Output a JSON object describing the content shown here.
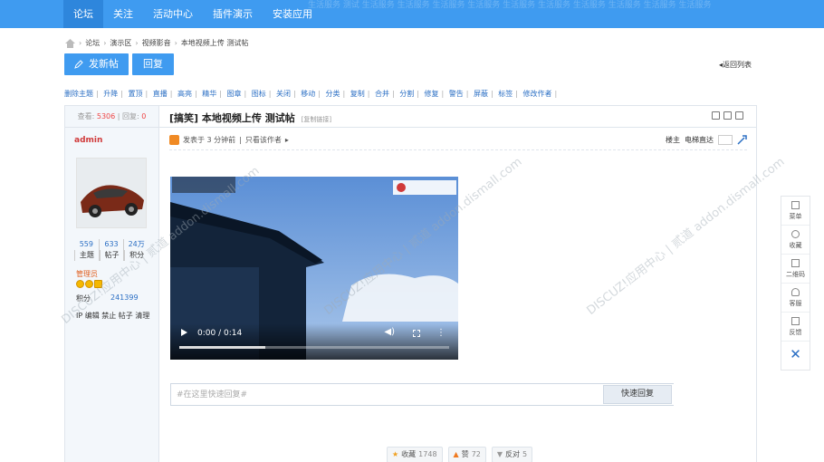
{
  "nav": {
    "items": [
      "论坛",
      "关注",
      "活动中心",
      "插件演示",
      "安装应用"
    ],
    "ghost": "生活服务 测试 生活服务 生活服务 生活服务 生活服务 生活服务 生活服务 生活服务 生活服务 生活服务 生活服务"
  },
  "breadcrumb": [
    "论坛",
    "演示区",
    "视频影音",
    "本地视频上传 测试帖"
  ],
  "buttons": {
    "new_post": "发新帖",
    "reply": "回复",
    "back_list": "返回列表"
  },
  "mod_actions": [
    "删除主题",
    "升降",
    "置顶",
    "直播",
    "高亮",
    "精华",
    "图章",
    "图标",
    "关闭",
    "移动",
    "分类",
    "复制",
    "合并",
    "分割",
    "修复",
    "警告",
    "屏蔽",
    "标签",
    "修改作者"
  ],
  "thread": {
    "views_label": "查看:",
    "views": "5306",
    "replies_label": "回复:",
    "replies": "0",
    "tag": "[搞笑]",
    "title": "本地视频上传 测试帖",
    "copy_link": "[复制链接]"
  },
  "author": {
    "name": "admin",
    "stats": [
      {
        "num": "559",
        "label": "主题"
      },
      {
        "num": "633",
        "label": "帖子"
      },
      {
        "num": "24万",
        "label": "积分"
      }
    ],
    "role": "管理员",
    "credits_label": "积分",
    "credits": "241399",
    "admin_links": "IP 编辑 禁止 帖子 清理"
  },
  "post_meta": {
    "posted_at": "发表于 3 分钟前",
    "only_author": "只看该作者",
    "floor": "楼主",
    "jump_to": "电梯直达"
  },
  "video": {
    "time": "0:00 / 0:14",
    "progress": 0.32
  },
  "reply_box": {
    "placeholder": "#在这里快速回复#",
    "button": "快速回复"
  },
  "post_actions": [
    {
      "label": "收藏",
      "count": "1748"
    },
    {
      "label": "赞",
      "count": "72"
    },
    {
      "label": "反对",
      "count": "5"
    }
  ],
  "float_bar": [
    "菜单",
    "收藏",
    "二维码",
    "客服",
    "反馈"
  ],
  "watermark": "DISCUZ!应用中心 | 贰道 addon.dismall.com",
  "colors": {
    "primary": "#3f9bf0",
    "link": "#2b6fc4",
    "author": "#d03a3a"
  }
}
